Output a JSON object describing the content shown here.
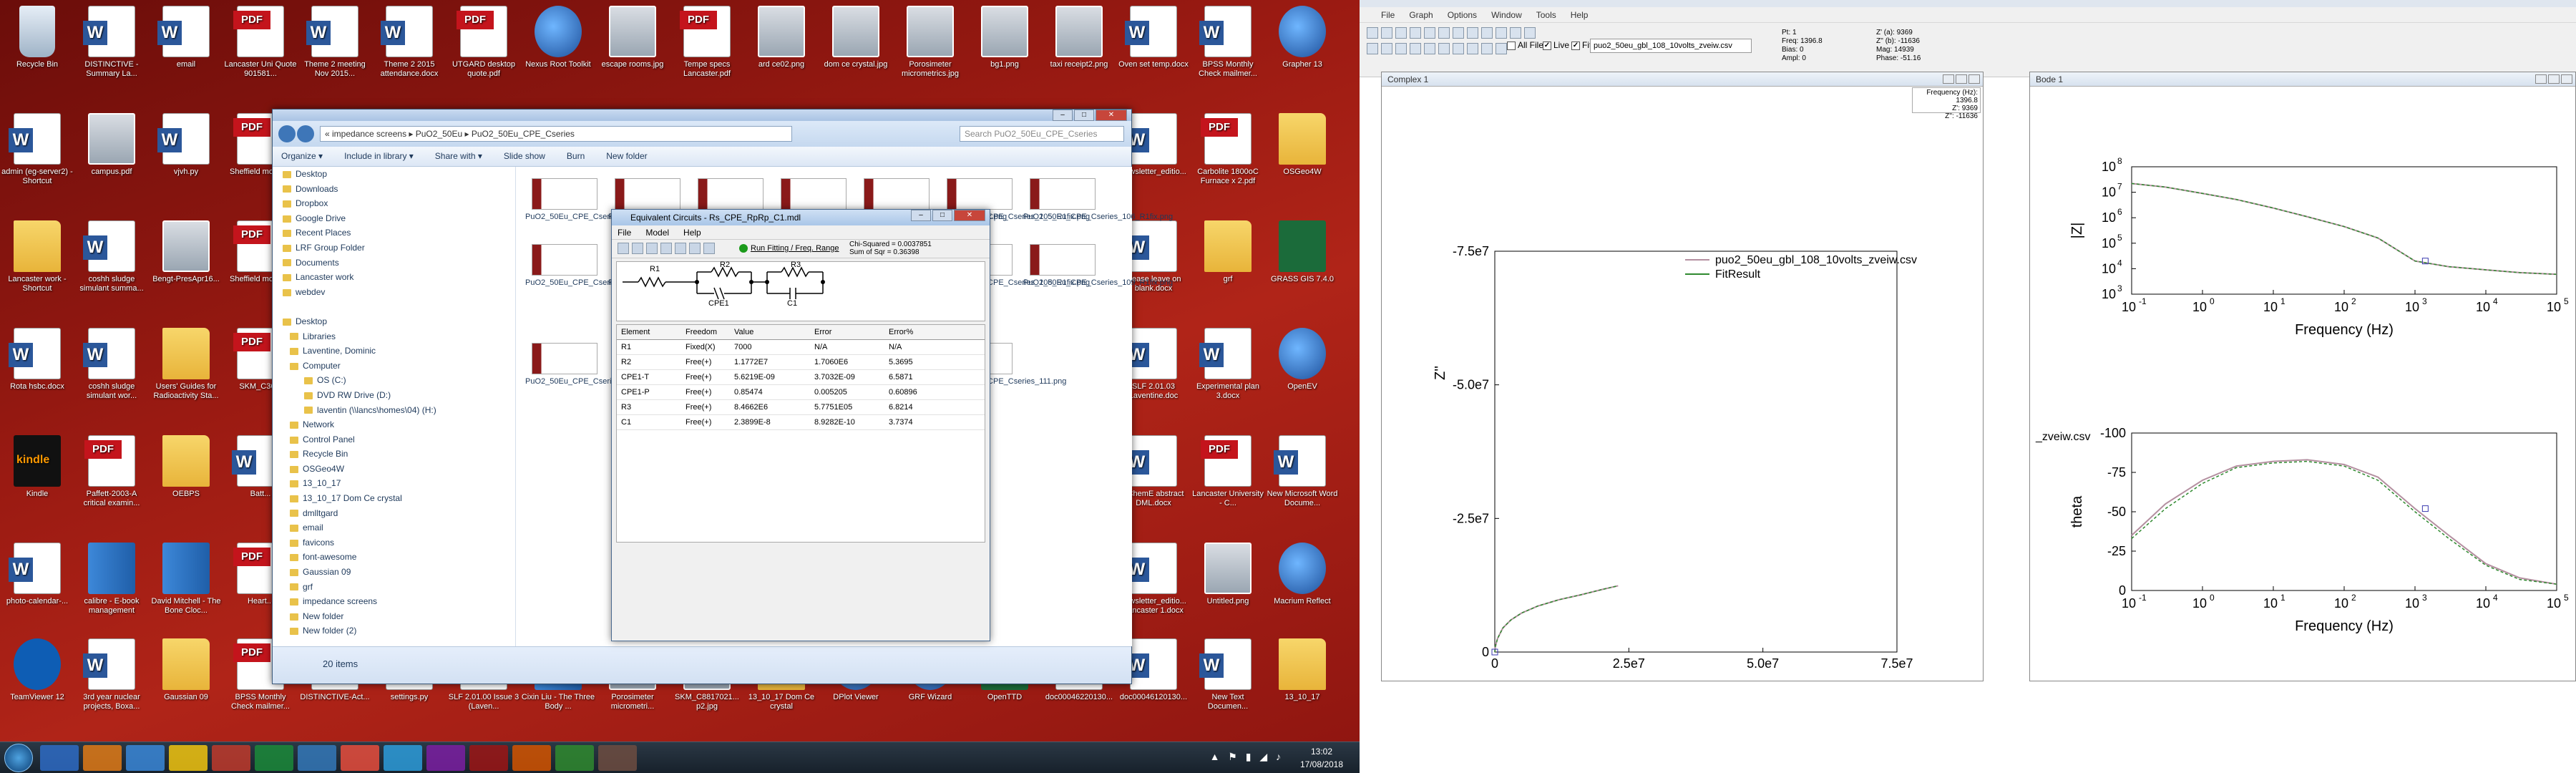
{
  "desktop": {
    "icons": [
      {
        "label": "Recycle Bin",
        "type": "bin"
      },
      {
        "label": "DISTINCTIVE - Summary La...",
        "type": "doc"
      },
      {
        "label": "email",
        "type": "doc"
      },
      {
        "label": "Lancaster Uni Quote 901581...",
        "type": "pdf"
      },
      {
        "label": "Theme 2 meeting Nov 2015...",
        "type": "doc"
      },
      {
        "label": "Theme 2 2015 attendance.docx",
        "type": "doc"
      },
      {
        "label": "UTGARD desktop quote.pdf",
        "type": "pdf"
      },
      {
        "label": "Nexus Root Toolkit",
        "type": "app"
      },
      {
        "label": "escape rooms.jpg",
        "type": "img"
      },
      {
        "label": "Tempe specs Lancaster.pdf",
        "type": "pdf"
      },
      {
        "label": "ard ce02.png",
        "type": "img"
      },
      {
        "label": "dom ce crystal.jpg",
        "type": "img"
      },
      {
        "label": "Porosimeter micrometrics.jpg",
        "type": "img"
      },
      {
        "label": "bg1.png",
        "type": "img"
      },
      {
        "label": "taxi receipt2.png",
        "type": "img"
      },
      {
        "label": "Oven set temp.docx",
        "type": "doc"
      },
      {
        "label": "BPSS Monthly Check mailmer...",
        "type": "doc"
      },
      {
        "label": "Grapher 13",
        "type": "app"
      },
      {
        "label": "admin (eg-server2) - Shortcut",
        "type": "doc"
      },
      {
        "label": "campus.pdf",
        "type": "img"
      },
      {
        "label": "vjvh.py",
        "type": "doc"
      },
      {
        "label": "Sheffield morph...",
        "type": "pdf"
      },
      {
        "label": "newsletter_editio...",
        "type": "doc"
      },
      {
        "label": "Carbolite 1800oC Furnace x 2.pdf",
        "type": "pdf"
      },
      {
        "label": "OSGeo4W",
        "type": "fold"
      },
      {
        "label": "Lancaster work - Shortcut",
        "type": "fold"
      },
      {
        "label": "coshh sludge simulant summa...",
        "type": "doc"
      },
      {
        "label": "Bengt-PresApr16...",
        "type": "img"
      },
      {
        "label": "Sheffield morph...",
        "type": "pdf"
      },
      {
        "label": "please leave on blank.docx",
        "type": "doc"
      },
      {
        "label": "grf",
        "type": "fold"
      },
      {
        "label": "GRASS GIS 7.4.0",
        "type": "grn"
      },
      {
        "label": "Rota hsbc.docx",
        "type": "doc"
      },
      {
        "label": "coshh sludge simulant wor...",
        "type": "doc"
      },
      {
        "label": "Users' Guides for Radioactivity Sta...",
        "type": "fold"
      },
      {
        "label": "SKM_C36...",
        "type": "pdf"
      },
      {
        "label": "SLF 2.01.03 Laventine.doc",
        "type": "doc"
      },
      {
        "label": "Experimental plan 3.docx",
        "type": "doc"
      },
      {
        "label": "OpenEV",
        "type": "app"
      },
      {
        "label": "Kindle",
        "type": "kin"
      },
      {
        "label": "Paffett-2003-A critical examin...",
        "type": "pdf"
      },
      {
        "label": "OEBPS",
        "type": "fold"
      },
      {
        "label": "Batt...",
        "type": "doc"
      },
      {
        "label": "I ChemE abstract DML.docx",
        "type": "doc"
      },
      {
        "label": "Lancaster University - C...",
        "type": "pdf"
      },
      {
        "label": "New Microsoft Word Docume...",
        "type": "doc"
      },
      {
        "label": "photo-calendar-...",
        "type": "doc"
      },
      {
        "label": "calibre - E-book management",
        "type": "book"
      },
      {
        "label": "David Mitchell - The Bone Cloc...",
        "type": "book"
      },
      {
        "label": "Heart...",
        "type": "pdf"
      },
      {
        "label": "newsletter_editio... Lancaster 1.docx",
        "type": "doc"
      },
      {
        "label": "Untitled.png",
        "type": "img"
      },
      {
        "label": "Macrium Reflect",
        "type": "app"
      },
      {
        "label": "TeamViewer 12",
        "type": "tv"
      },
      {
        "label": "3rd year nuclear projects, Boxa...",
        "type": "doc"
      },
      {
        "label": "Gaussian 09",
        "type": "fold"
      },
      {
        "label": "BPSS Monthly Check mailmer...",
        "type": "pdf"
      },
      {
        "label": "doc00046120130...",
        "type": "doc"
      },
      {
        "label": "New Text Documen...",
        "type": "doc"
      },
      {
        "label": "13_10_17",
        "type": "fold"
      },
      {
        "label": "DISTINCTIVE-Act...",
        "type": "doc"
      },
      {
        "label": "settings.py",
        "type": "doc"
      },
      {
        "label": "SLF 2.01.00 Issue 3 (Laven...",
        "type": "doc"
      },
      {
        "label": "Cixin Liu - The Three Body ...",
        "type": "book"
      },
      {
        "label": "Porosimeter micrometri...",
        "type": "img"
      },
      {
        "label": "SKM_C8817021... p2.jpg",
        "type": "img"
      },
      {
        "label": "13_10_17 Dom Ce crystal",
        "type": "fold"
      },
      {
        "label": "DPlot Viewer",
        "type": "app"
      },
      {
        "label": "GRF Wizard",
        "type": "app"
      },
      {
        "label": "OpenTTD",
        "type": "grn"
      },
      {
        "label": "doc00046220130...",
        "type": "pdf"
      }
    ]
  },
  "taskbar": {
    "time": "13:02",
    "date": "17/08/2018",
    "tray": "▲ ⚑ ▮ ◢ ♪"
  },
  "explorer": {
    "address": "« impedance screens ▸ PuO2_50Eu ▸ PuO2_50Eu_CPE_Cseries",
    "search_placeholder": "Search PuO2_50Eu_CPE_Cseries",
    "cmd": [
      "Organize ▾",
      "Include in library ▾",
      "Share with ▾",
      "Slide show",
      "Burn",
      "New folder"
    ],
    "nav": [
      "Desktop",
      "Downloads",
      "Dropbox",
      "Google Drive",
      "Recent Places",
      "LRF Group Folder",
      "Documents",
      "Lancaster work",
      "webdev",
      "",
      "Desktop",
      "Libraries",
      "Laventine, Dominic",
      "Computer",
      "OS (C:)",
      "DVD RW Drive (D:)",
      "laventin (\\\\lancs\\homes\\04) (H:)",
      "Network",
      "Control Panel",
      "Recycle Bin",
      "OSGeo4W",
      "13_10_17",
      "13_10_17 Dom Ce crystal",
      "dmlltgard",
      "email",
      "favicons",
      "font-awesome",
      "Gaussian 09",
      "grf",
      "impedance screens",
      "New folder",
      "New folder (2)"
    ],
    "files": [
      "PuO2_50Eu_CPE_Cseries_100_R1fix.png",
      "PuO2_50Eu_CPE_Cseries_101_R1fix.png",
      "PuO2_50Eu_CPE_Cseries_102_R1fix.png",
      "PuO2_50Eu_CPE_Cseries_103_R1fix.png",
      "PuO2_50Eu_CPE_Cseries_104_R1fix.png",
      "PuO2_50Eu_CPE_Cseries_105_R1fix.png",
      "PuO2_50Eu_CPE_Cseries_106_R1fix.png",
      "PuO2_50Eu_CPE_Cseries_104.png",
      "PuO2_50Eu_CPE_Cseries_107.png",
      "PuO2_50Eu_CPE_Cseries_108_R1fix.png",
      "PuO2_50Eu_CPE_Cseries_109_R1fix.png",
      "PuO2_50Eu_CPE_Cseries_110_R1fix.png",
      "PuO2_50Eu_CPE_Cseries_111.png"
    ],
    "status": "20 items"
  },
  "equiv": {
    "title": "Equivalent Circuits - Rs_CPE_RpRp_C1.mdl",
    "menu": [
      "File",
      "Model",
      "Help"
    ],
    "run": "Run Fitting / Freq. Range",
    "chi": "Chi-Squared = 0.0037851",
    "sos": "Sum of Sqr = 0.36398",
    "labels": [
      "R1",
      "R2",
      "R3",
      "CPE1",
      "C1"
    ],
    "headers": [
      "Element",
      "Freedom",
      "Value",
      "Error",
      "Error%"
    ],
    "rows": [
      [
        "R1",
        "Fixed(X)",
        "7000",
        "N/A",
        "N/A"
      ],
      [
        "R2",
        "Free(+)",
        "1.1772E7",
        "1.7060E6",
        "5.3695"
      ],
      [
        "CPE1-T",
        "Free(+)",
        "5.6219E-09",
        "3.7032E-09",
        "6.5871"
      ],
      [
        "CPE1-P",
        "Free(+)",
        "0.85474",
        "0.005205",
        "0.60896"
      ],
      [
        "R3",
        "Free(+)",
        "8.4662E6",
        "5.7751E05",
        "6.8214"
      ],
      [
        "C1",
        "Free(+)",
        "2.3899E-8",
        "8.9282E-10",
        "3.7374"
      ]
    ]
  },
  "zview": {
    "menu": [
      "File",
      "Graph",
      "Options",
      "Window",
      "Tools",
      "Help"
    ],
    "checks": [
      "All Files",
      "Live",
      "Fit"
    ],
    "combo": "puo2_50eu_gbl_108_10volts_zveiw.csv",
    "info": [
      "Pt: 1",
      "Freq: 1396.8",
      "Bias: 0",
      "Ampl: 0"
    ],
    "info2": [
      "Z' (a): 9369",
      "Z'' (b): -11636",
      "Mag: 14939",
      "Phase: -51.16"
    ],
    "complex_title": "Complex 1",
    "bode_title": "Bode 1",
    "tooltip": [
      "Frequency (Hz): 1396.8",
      "Z': 9369",
      "Z'': -11636"
    ],
    "legend": [
      "puo2_50eu_gbl_108_10volts_zveiw.csv",
      "FitResult"
    ],
    "bode_legend_fragment": "_zveiw.csv",
    "colors": {
      "data": "#b48fa0",
      "fit": "#2f8a2f",
      "marker": "#3a3ab0"
    }
  },
  "chart_data": [
    {
      "type": "scatter",
      "title": "Complex 1",
      "xlabel": "Z'",
      "ylabel": "Z''",
      "xlim": [
        0,
        75000000.0
      ],
      "ylim": [
        0,
        -75000000.0
      ],
      "xticks": [
        "0",
        "2.5e7",
        "5.0e7",
        "7.5e7"
      ],
      "yticks": [
        "-7.5e7",
        "-5.0e7",
        "-2.5e7",
        "0"
      ],
      "series": [
        {
          "name": "puo2_50eu_gbl_108_10volts_zveiw.csv",
          "x": [
            0,
            100000.0,
            500000.0,
            1500000.0,
            3000000.0,
            5000000.0,
            8000000.0,
            12000000.0,
            16000000.0,
            20000000.0,
            23000000.0
          ],
          "y": [
            0,
            -1000000.0,
            -2500000.0,
            -4500000.0,
            -6000000.0,
            -7300000.0,
            -8600000.0,
            -9800000.0,
            -10700000.0,
            -11700000.0,
            -12400000.0
          ]
        },
        {
          "name": "FitResult",
          "x": [
            0,
            100000.0,
            500000.0,
            1500000.0,
            3000000.0,
            5000000.0,
            8000000.0,
            12000000.0,
            16000000.0,
            20000000.0,
            23000000.0
          ],
          "y": [
            0,
            -1000000.0,
            -2500000.0,
            -4500000.0,
            -6000000.0,
            -7300000.0,
            -8600000.0,
            -9800000.0,
            -10700000.0,
            -11700000.0,
            -12400000.0
          ]
        }
      ]
    },
    {
      "type": "line",
      "title": "Bode 1 - |Z|",
      "xlabel": "Frequency (Hz)",
      "ylabel": "|Z|",
      "xlim": [
        0.1,
        100000.0
      ],
      "ylim": [
        1000.0,
        100000000.0
      ],
      "xscale": "log",
      "yscale": "log",
      "series": [
        {
          "name": "puo2_50eu_gbl_108_10volts_zveiw.csv",
          "x": [
            0.1,
            0.3,
            1,
            3,
            10,
            30,
            100,
            300,
            1000,
            3000,
            10000.0,
            30000.0,
            100000.0
          ],
          "y": [
            22000000.0,
            16000000.0,
            9000000.0,
            5200000.0,
            2400000.0,
            1100000.0,
            450000.0,
            160000.0,
            20000.0,
            12000.0,
            9000.0,
            7000.0,
            6000.0
          ]
        },
        {
          "name": "FitResult",
          "x": [
            0.1,
            0.3,
            1,
            3,
            10,
            30,
            100,
            300,
            1000,
            3000,
            10000.0,
            30000.0,
            100000.0
          ],
          "y": [
            22000000.0,
            16000000.0,
            9000000.0,
            5200000.0,
            2400000.0,
            1100000.0,
            450000.0,
            160000.0,
            20000.0,
            12000.0,
            9000.0,
            7000.0,
            6000.0
          ]
        }
      ]
    },
    {
      "type": "line",
      "title": "Bode 1 - theta",
      "xlabel": "Frequency (Hz)",
      "ylabel": "theta",
      "xlim": [
        0.1,
        100000.0
      ],
      "ylim": [
        0,
        -100
      ],
      "xscale": "log",
      "series": [
        {
          "name": "puo2_50eu_gbl_108_10volts_zveiw.csv",
          "x": [
            0.1,
            0.3,
            1,
            3,
            10,
            30,
            100,
            300,
            1000,
            3000,
            10000.0,
            30000.0,
            100000.0
          ],
          "y": [
            -35,
            -55,
            -70,
            -79,
            -82,
            -83,
            -80,
            -72,
            -52,
            -35,
            -17,
            -8,
            -4
          ]
        },
        {
          "name": "FitResult",
          "x": [
            0.1,
            0.3,
            1,
            3,
            10,
            30,
            100,
            300,
            1000,
            3000,
            10000.0,
            30000.0,
            100000.0
          ],
          "y": [
            -33,
            -52,
            -68,
            -78,
            -81,
            -82,
            -79,
            -70,
            -50,
            -33,
            -16,
            -7,
            -4
          ]
        }
      ]
    }
  ]
}
